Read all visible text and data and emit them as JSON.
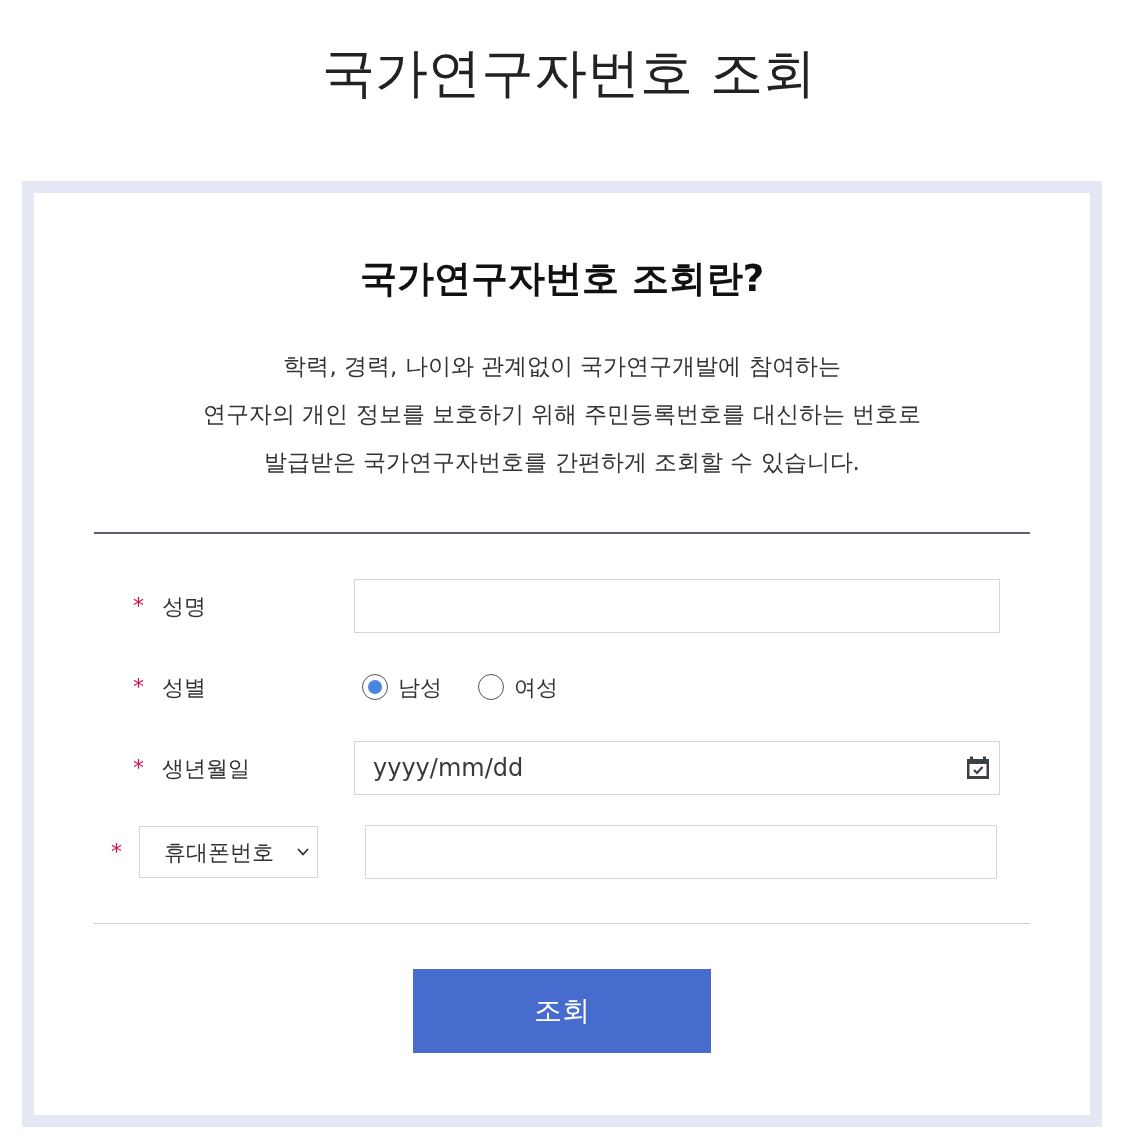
{
  "page_title": "국가연구자번호 조회",
  "intro": {
    "heading": "국가연구자번호 조회란?",
    "lines": [
      "학력, 경력, 나이와 관계없이 국가연구개발에 참여하는",
      "연구자의 개인 정보를 보호하기 위해 주민등록번호를 대신하는 번호로",
      "발급받은 국가연구자번호를 간편하게 조회할 수 있습니다."
    ]
  },
  "form": {
    "fields": [
      {
        "kind": "text",
        "required_mark": "*",
        "label": "성명"
      },
      {
        "kind": "radio",
        "required_mark": "*",
        "label": "성별",
        "options": [
          {
            "label": "남성",
            "selected": true
          },
          {
            "label": "여성",
            "selected": false
          }
        ]
      },
      {
        "kind": "date",
        "required_mark": "*",
        "label": "생년월일",
        "placeholder": "yyyy/mm/dd"
      },
      {
        "kind": "select",
        "required_mark": "*",
        "select_value": "휴대폰번호"
      }
    ]
  },
  "submit": {
    "label": "조회"
  }
}
